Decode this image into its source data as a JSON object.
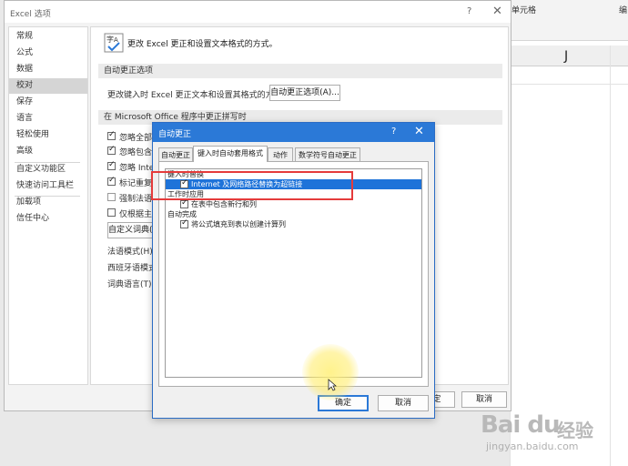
{
  "spreadsheet": {
    "cell_style_label": "单元格",
    "right_label": "编",
    "column_label": "J"
  },
  "options_window": {
    "title": "Excel 选项",
    "help": "?",
    "close": "✕",
    "nav": [
      "常规",
      "公式",
      "数据",
      "校对",
      "保存",
      "语言",
      "轻松使用",
      "高级",
      "自定义功能区",
      "快速访问工具栏",
      "加载项",
      "信任中心"
    ],
    "selected_nav": "校对",
    "headline": "更改 Excel 更正和设置文本格式的方式。",
    "section_autocorrect": "自动更正选项",
    "autocorrect_desc": "更改键入时 Excel 更正文本和设置其格式的方式:",
    "autocorrect_button": "自动更正选项(A)...",
    "section_spelling": "在 Microsoft Office 程序中更正拼写时",
    "checks": [
      "忽略全部大",
      "忽略包含数",
      "忽略 Intern",
      "标记重复单",
      "强制法语大",
      "仅根据主词"
    ],
    "custom_dict_button": "自定义词典(C",
    "french_modes": "法语模式(H):",
    "spanish_modes": "西班牙语模式(",
    "dict_language": "词典语言(T):",
    "ok_partial": "定",
    "cancel": "取消"
  },
  "autocorrect_dialog": {
    "title": "自动更正",
    "help": "?",
    "close": "✕",
    "tabs": [
      "自动更正",
      "键入时自动套用格式",
      "动作",
      "数学符号自动更正"
    ],
    "active_tab": "键入时自动套用格式",
    "list": {
      "group_replace": "键入时替换",
      "item_internet": "Internet 及网络路径替换为超链接",
      "group_apply": "工作时应用",
      "item_table_rows": "在表中包含新行和列",
      "group_auto_complete": "自动完成",
      "item_formulas": "将公式填充到表以创建计算列"
    },
    "ok": "确定",
    "cancel": "取消"
  },
  "watermark": {
    "logo": "Bai du",
    "jingyan": "经验",
    "url": "jingyan.baidu.com"
  },
  "colors": {
    "accent_blue": "#2b79d7",
    "selection_blue": "#1e73d9",
    "highlight_red": "#e53b3b"
  }
}
